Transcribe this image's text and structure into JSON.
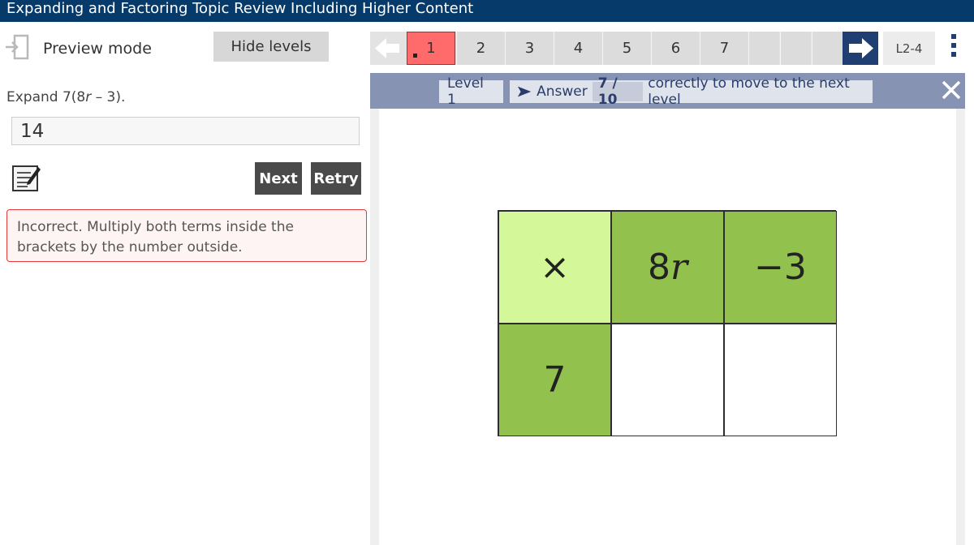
{
  "app": {
    "title": "Expanding and Factoring Topic Review Including Higher Content"
  },
  "left_panel": {
    "mode_icon": "exit-door-icon",
    "mode_label": "Preview mode",
    "hide_levels_label": "Hide levels",
    "question_prefix": "Expand 7(8",
    "question_var": "r",
    "question_suffix": " – 3).",
    "answer_value": "14",
    "notes_icon": "notepad-icon",
    "next_label": "Next",
    "retry_label": "Retry",
    "feedback": "Incorrect. Multiply both terms inside the brackets by the number outside."
  },
  "level_nav": {
    "levels": [
      "1",
      "2",
      "3",
      "4",
      "5",
      "6",
      "7"
    ],
    "active_level": "1",
    "prev_icon": "arrow-left-icon",
    "next_icon": "arrow-right-icon",
    "range_label": "L2-4",
    "menu_icon": "kebab-menu-icon"
  },
  "info_bar": {
    "level_label": "Level 1",
    "goal_icon": "play-arrow-icon",
    "goal_prefix": "Answer",
    "goal_score": "7 / 10",
    "goal_suffix": "correctly to move to the next level",
    "close_icon": "close-icon"
  },
  "grid_method": {
    "header_symbol": "×",
    "term1_coef": "8",
    "term1_var": "r",
    "term2": "−3",
    "multiplier": "7",
    "answer_cells": [
      "",
      ""
    ]
  },
  "colors": {
    "title_bar": "#063a6a",
    "active_level": "#ff6b6b",
    "info_bar": "#8793b3",
    "grid_header_light": "#d3f799",
    "grid_header_green": "#92c14d",
    "feedback_border": "#e03a3a"
  }
}
